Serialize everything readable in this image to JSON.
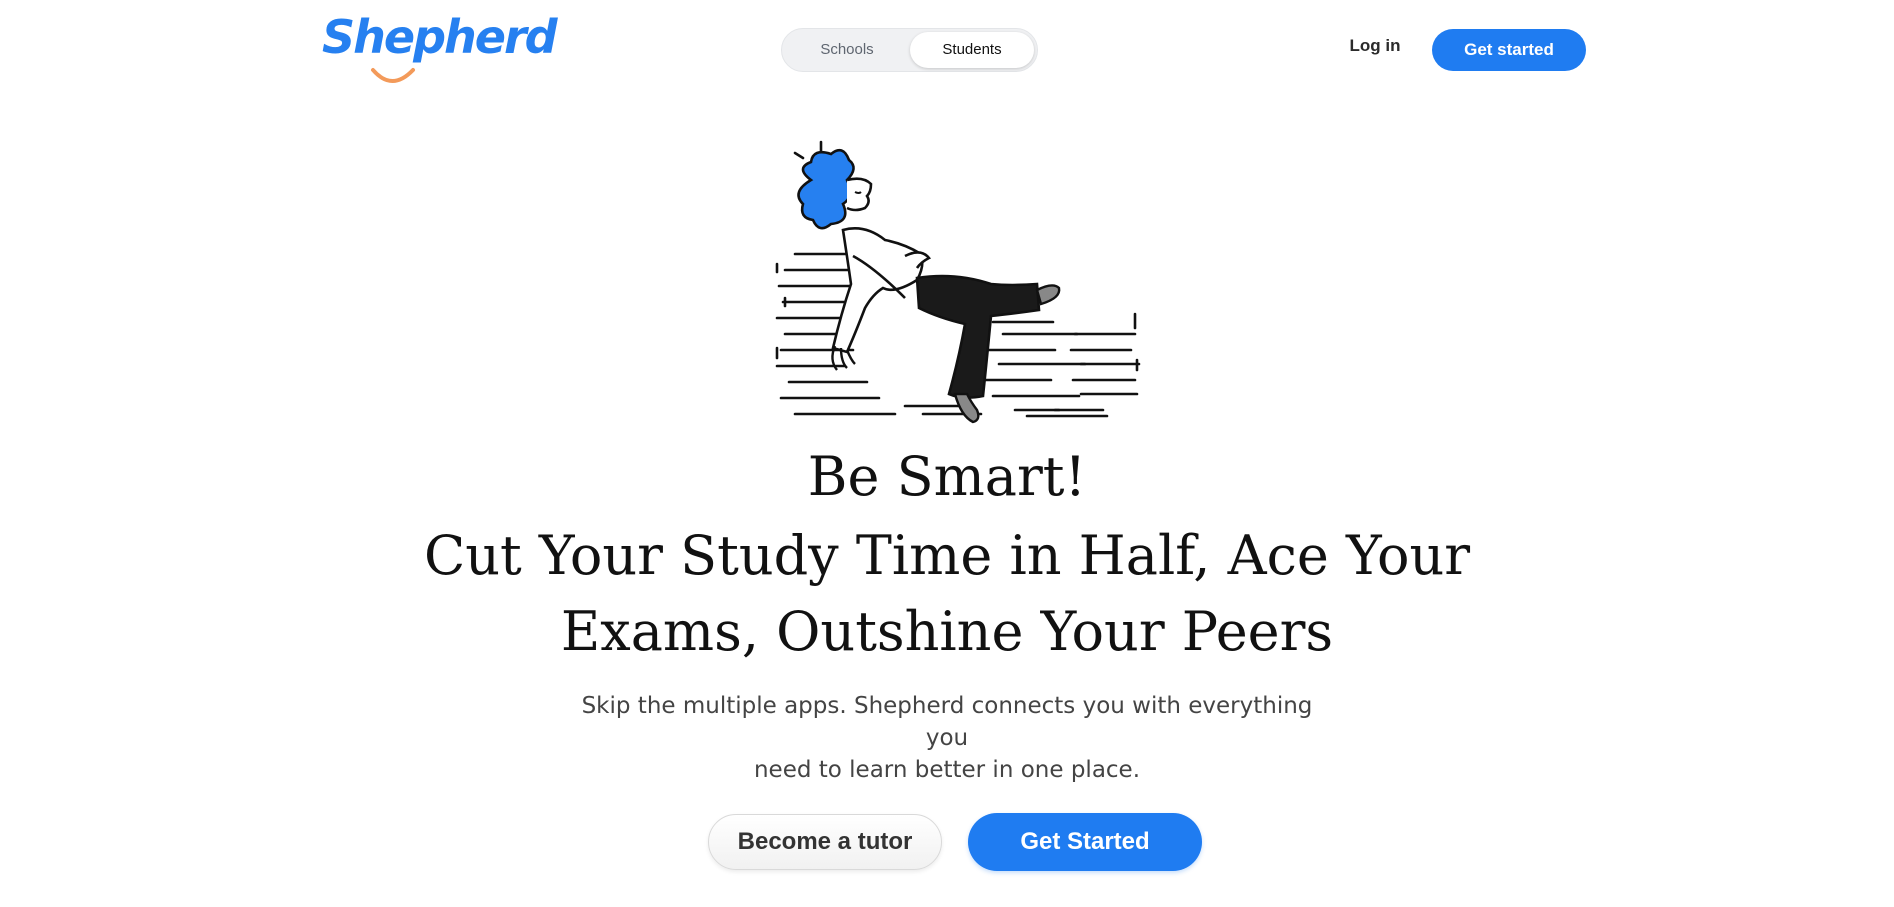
{
  "header": {
    "logo_text": "Shepherd",
    "toggle": {
      "schools_label": "Schools",
      "students_label": "Students",
      "selected": "Students"
    },
    "login_label": "Log in",
    "cta_label": "Get started"
  },
  "hero": {
    "line1": "Be Smart!",
    "line2": "Cut Your Study Time in Half, Ace Your",
    "line3": "Exams, Outshine Your Peers",
    "subtitle_line1": "Skip the multiple apps. Shepherd connects you with everything you",
    "subtitle_line2": "need to learn better in one place."
  },
  "actions": {
    "tutor_label": "Become a tutor",
    "start_label": "Get Started"
  },
  "colors": {
    "brand_blue": "#1f7cf1",
    "logo_smile": "#f39a5a",
    "text": "#111111",
    "subtitle": "#444444"
  },
  "illustration": {
    "icon": "person-relaxing-on-books-illustration"
  }
}
